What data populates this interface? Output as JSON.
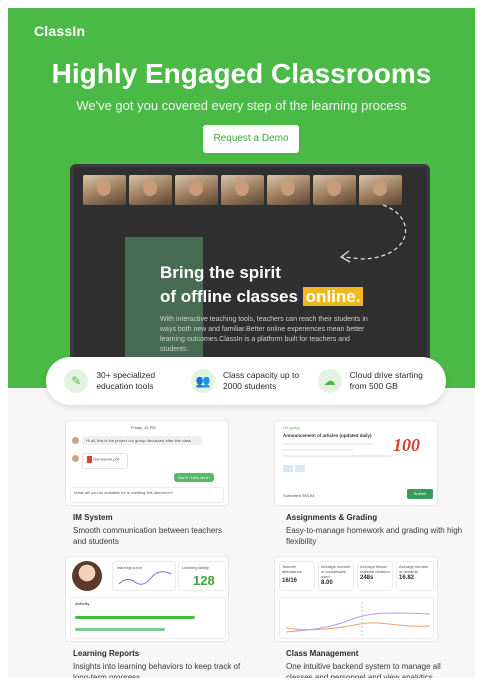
{
  "brand": {
    "logo": "ClassIn"
  },
  "hero": {
    "title": "Highly Engaged Classrooms",
    "subtitle": "We've got you covered every step of the learning process",
    "cta": "Request a Demo"
  },
  "laptop": {
    "headline_line1": "Bring the spirit",
    "headline_line2_pre": "of offline classes ",
    "headline_highlight": "online.",
    "description": "With interactive teaching tools, teachers can reach their students in ways both new and familiar.Better online experiences mean better learning outcomes.ClassIn is a platform built for teachers and students."
  },
  "features": [
    {
      "icon": "edit-icon",
      "text": "30+ specialized education tools"
    },
    {
      "icon": "users-icon",
      "text": "Class capacity up to 2000 students"
    },
    {
      "icon": "cloud-icon",
      "text": "Cloud drive starting from 500 GB"
    }
  ],
  "cards": {
    "im": {
      "title": "IM System",
      "text": "Smooth communication between teachers and students",
      "date": "Friday, 16 PM",
      "msg1": "Hi all, this is the project our group discussed after this class",
      "file": "Homework.pdf",
      "msg2": "Got it ! Let's do it !",
      "input": "What will you be available for in meeting this afternoon?"
    },
    "assign": {
      "title": "Assignments & Grading",
      "text": "Easy-to-manage homework and grading with high flexibility",
      "status": "On-going",
      "heading": "Announcement of articles (updated daily)",
      "score": "100",
      "submitted": "Submitted 98/194",
      "submit": "Submit"
    },
    "reports": {
      "title": "Learning Reports",
      "text": "Insights into learning behaviors to keep track of long-term progress",
      "curve_label": "learning curve",
      "ability_label": "Learning ability",
      "ability_value": "128",
      "activity": "Activity"
    },
    "manage": {
      "title": "Class Management",
      "text": "One intuitive backend system to manage all classes and personnel and view analytics",
      "stats": [
        {
          "label": "Teacher attendance",
          "value": "16/16"
        },
        {
          "label": "Average number of courseware used",
          "value": "8.00"
        },
        {
          "label": "Average lesson material duration",
          "value": "248s"
        },
        {
          "label": "Average number of rewards",
          "value": "16.82"
        }
      ]
    }
  },
  "colors": {
    "brand_green": "#4bb946",
    "highlight": "#f1b721",
    "score_red": "#d9412b"
  }
}
